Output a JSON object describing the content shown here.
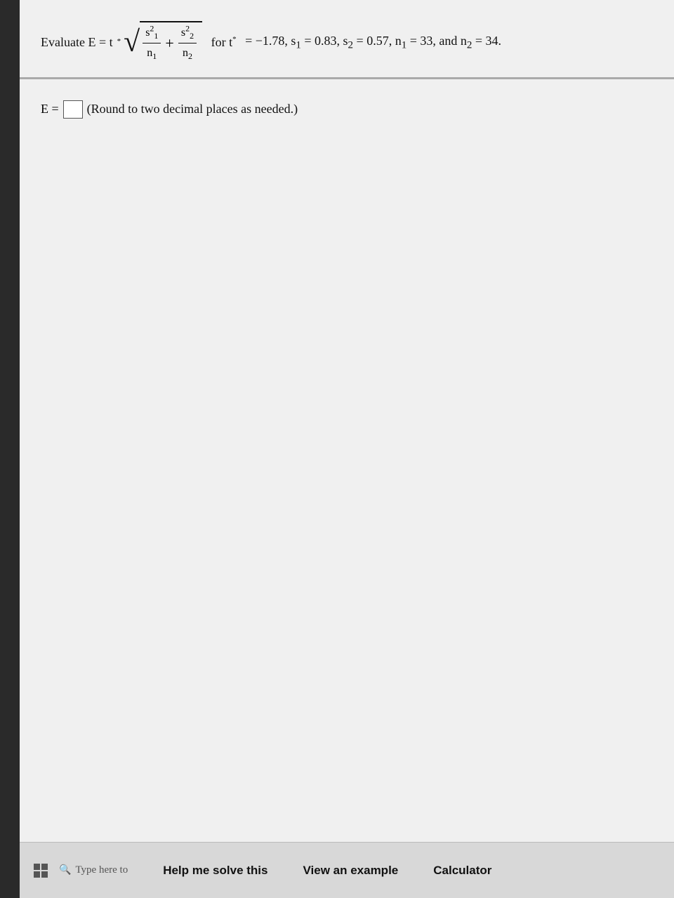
{
  "page": {
    "background_left_bar": "#2a2a2a",
    "background_main": "#f0f0f0"
  },
  "problem": {
    "evaluate_prefix": "Evaluate E = t",
    "asterisk": "*",
    "for_t_label": "for t",
    "t_star_label": "t",
    "equals_label": "=",
    "conditions": "= −1.78, s₁ = 0.83, s₂ = 0.57, n₁ = 33, and n₂ = 34.",
    "fraction1_numerator": "s",
    "fraction1_numerator_sup": "2",
    "fraction1_numerator_sub": "1",
    "fraction1_denominator": "n",
    "fraction1_denominator_sub": "1",
    "fraction2_numerator": "s",
    "fraction2_numerator_sup": "2",
    "fraction2_numerator_sub": "2",
    "fraction2_denominator": "n",
    "fraction2_denominator_sub": "2",
    "plus_sign": "+",
    "for_text": "for t"
  },
  "answer": {
    "label_prefix": "E =",
    "hint": "(Round to two decimal places as needed.)"
  },
  "bottom_bar": {
    "search_placeholder": "Type here to",
    "help_button": "Help me solve this",
    "example_button": "View an example",
    "calculator_button": "Calculator"
  }
}
